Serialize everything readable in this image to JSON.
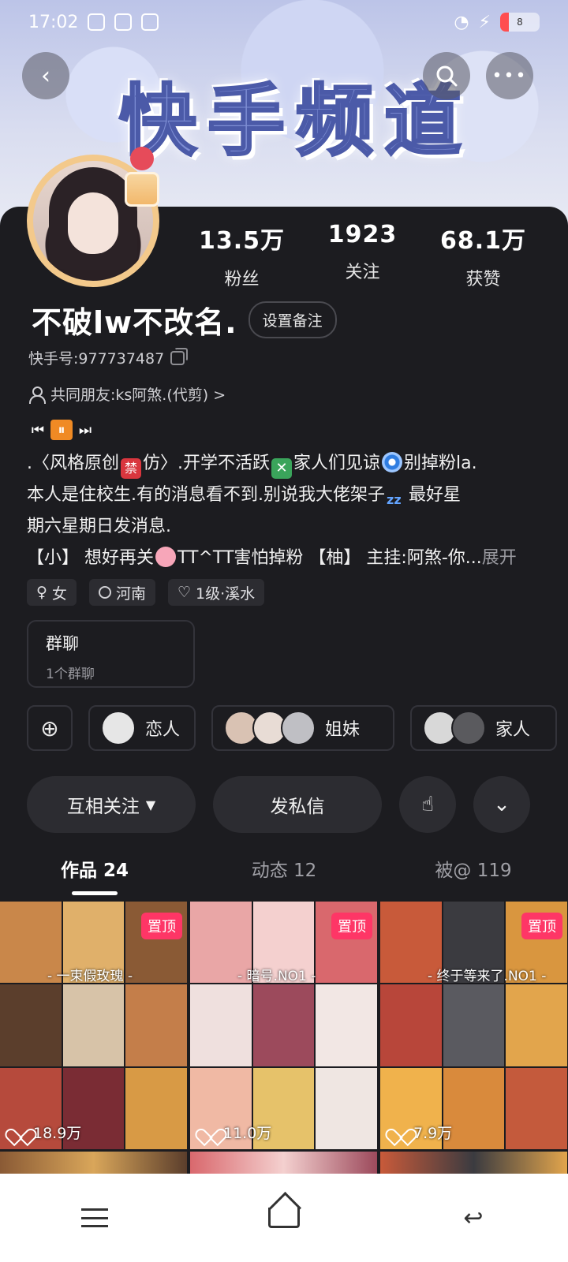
{
  "status_bar": {
    "time": "17:02",
    "battery": "8"
  },
  "header": {
    "banner_text": "快手频道",
    "back_icon": "chevron-left-icon",
    "search_icon": "search-icon",
    "more_icon": "more-dots-icon"
  },
  "profile": {
    "stats": [
      {
        "value": "13.5万",
        "label": "粉丝"
      },
      {
        "value": "1923",
        "label": "关注"
      },
      {
        "value": "68.1万",
        "label": "获赞"
      }
    ],
    "name": "不破lw不改名.",
    "remark_button": "设置备注",
    "kuaishou_id": "快手号:977737487",
    "mutual_friends": "共同朋友:ks阿煞.(代剪) >",
    "bio": {
      "line1a": ".〈风格原创",
      "line1b": "仿〉.开学不活跃",
      "line1c": "家人们见谅",
      "line1d": "别掉粉la.",
      "line2a": "本人是住校生.有的消息看不到.别说我大佬架子",
      "line2b": "最好星",
      "line3": "期六星期日发消息.",
      "line4": "【小】 想好再关",
      "line4b": "TT^TT害怕掉粉 【柚】 主挂:阿煞-你...",
      "expand": "展开",
      "ban_glyph": "禁"
    },
    "tags": [
      {
        "icon": "female-icon",
        "label": "女"
      },
      {
        "icon": "location-icon",
        "label": "河南"
      },
      {
        "icon": "heart-icon",
        "label": "1级·溪水"
      }
    ],
    "group_chat": {
      "title": "群聊",
      "subtitle": "1个群聊"
    },
    "relations": [
      {
        "label": "恋人"
      },
      {
        "label": "姐妹"
      },
      {
        "label": "家人"
      }
    ],
    "actions": {
      "follow": "互相关注",
      "message": "发私信"
    },
    "tabs": [
      {
        "label": "作品 24",
        "active": true
      },
      {
        "label": "动态 12",
        "active": false
      },
      {
        "label": "被@ 119",
        "active": false
      }
    ]
  },
  "works": [
    {
      "badge": "置顶",
      "caption": "- 一束假玫瑰 -",
      "likes": "18.9万",
      "colors": [
        "#c9874a",
        "#e0b06a",
        "#8a5a35",
        "#5b3e2c",
        "#d7c3a8",
        "#c47e4a",
        "#b64a3c",
        "#7a2c34",
        "#d89a45"
      ]
    },
    {
      "badge": "置顶",
      "caption": "- 暗号.NO1 -",
      "likes": "11.0万",
      "colors": [
        "#e9a6a6",
        "#f4d0cf",
        "#d9686d",
        "#efe0de",
        "#9c4a5c",
        "#f2e7e4",
        "#f0b9a4",
        "#e6c26a",
        "#efe6e2"
      ]
    },
    {
      "badge": "置顶",
      "caption": "- 终于等来了.NO1 -",
      "likes": "7.9万",
      "colors": [
        "#c85a3a",
        "#3b3b40",
        "#d9963f",
        "#b8463a",
        "#5a5a60",
        "#e2a54c",
        "#f0b24c",
        "#d98a3c",
        "#c45a3c"
      ]
    }
  ]
}
